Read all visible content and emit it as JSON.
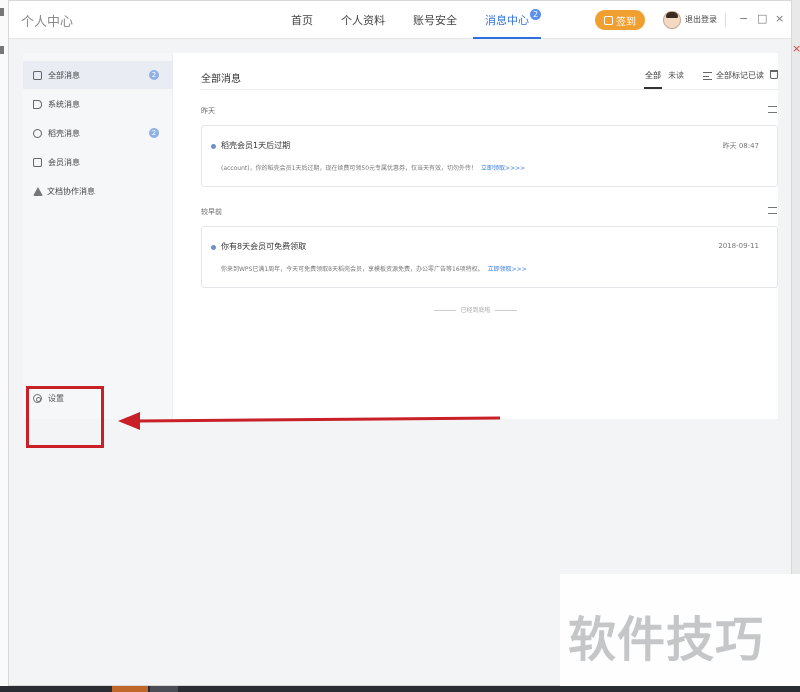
{
  "app": {
    "title": "个人中心",
    "nav": [
      {
        "label": "首页",
        "active": false
      },
      {
        "label": "个人资料",
        "active": false
      },
      {
        "label": "账号安全",
        "active": false
      },
      {
        "label": "消息中心",
        "active": true,
        "badge": "2"
      }
    ],
    "signin_label": "签到",
    "logout_label": "退出登录",
    "window_controls": {
      "minimize": "−",
      "maximize": "□",
      "close": "×"
    }
  },
  "sidebar": {
    "items": [
      {
        "label": "全部消息",
        "icon": "chat-icon",
        "badge": "2",
        "active": true
      },
      {
        "label": "系统消息",
        "icon": "speaker-icon",
        "badge": "",
        "active": false
      },
      {
        "label": "稻壳消息",
        "icon": "docer-icon",
        "badge": "2",
        "active": false
      },
      {
        "label": "会员消息",
        "icon": "member-icon",
        "badge": "",
        "active": false
      },
      {
        "label": "文档协作消息",
        "icon": "share-icon",
        "badge": "",
        "active": false
      }
    ],
    "settings_label": "设置"
  },
  "main": {
    "title": "全部消息",
    "filter_all": "全部",
    "filter_unread": "未读",
    "mark_all_read": "全部标记已读",
    "groups": [
      {
        "label": "昨天",
        "card": {
          "title": "稻壳会员1天后过期",
          "time": "昨天 08:47",
          "body": "(account)，你的稻壳会员1天后过期，现在续费可领50元专属优惠券，仅当天有效，切勿外传！",
          "link": "立即领取>>>>"
        }
      },
      {
        "label": "较早前",
        "card": {
          "title": "你有8天会员可免费领取",
          "time": "2018-09-11",
          "body": "你来到WPS已满1周年，今天可免费领取8天稻壳会员，享模板资源免费，办公零广告等16项特权。",
          "link": "立即领取>>>"
        }
      }
    ],
    "end_note": "已经到底啦"
  },
  "watermark": "软件技巧",
  "colors": {
    "accent": "#2f6fde",
    "signin": "#f0a030",
    "annotation": "#c91f27"
  }
}
